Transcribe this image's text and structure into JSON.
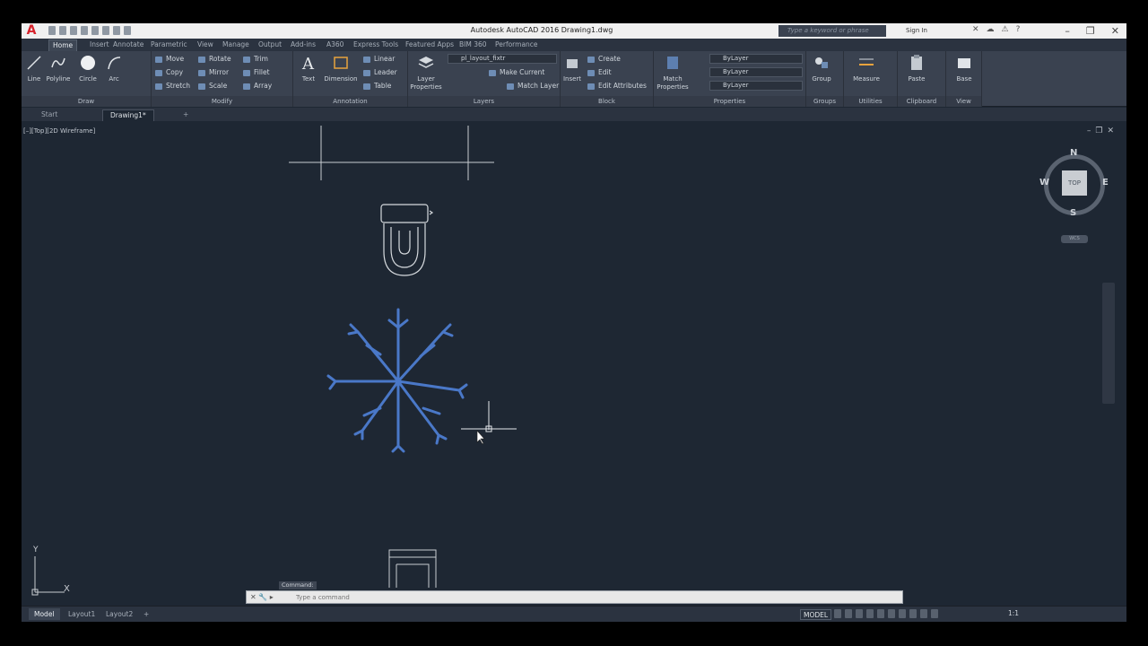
{
  "app": {
    "title": "Autodesk AutoCAD 2016   Drawing1.dwg",
    "logo": "A",
    "search_placeholder": "Type a keyword or phrase",
    "signin_label": "Sign In"
  },
  "ribbon_tabs": [
    "Home",
    "Insert",
    "Annotate",
    "Parametric",
    "View",
    "Manage",
    "Output",
    "Add-ins",
    "A360",
    "Express Tools",
    "Featured Apps",
    "BIM 360",
    "Performance"
  ],
  "draw": {
    "label": "Draw",
    "line": "Line",
    "polyline": "Polyline",
    "circle": "Circle",
    "arc": "Arc"
  },
  "modify": {
    "label": "Modify",
    "move": "Move",
    "rotate": "Rotate",
    "trim": "Trim",
    "copy": "Copy",
    "mirror": "Mirror",
    "fillet": "Fillet",
    "stretch": "Stretch",
    "scale": "Scale",
    "array": "Array"
  },
  "annotation": {
    "label": "Annotation",
    "text": "Text",
    "dimension": "Dimension",
    "linear": "Linear",
    "leader": "Leader",
    "table": "Table"
  },
  "layers": {
    "label": "Layers",
    "layer_properties": "Layer Properties",
    "current_layer": "pl_layout_fixtr",
    "make_current": "Make Current",
    "match_layer": "Match Layer"
  },
  "block": {
    "label": "Block",
    "insert": "Insert",
    "create": "Create",
    "edit": "Edit",
    "edit_attributes": "Edit Attributes"
  },
  "properties": {
    "label": "Properties",
    "match_properties": "Match Properties",
    "color": "ByLayer",
    "linetype": "ByLayer",
    "lineweight": "ByLayer"
  },
  "groups": {
    "label": "Groups",
    "group": "Group"
  },
  "utilities": {
    "label": "Utilities",
    "measure": "Measure"
  },
  "clipboard": {
    "label": "Clipboard",
    "paste": "Paste"
  },
  "view_panel": {
    "label": "View",
    "base": "Base"
  },
  "file_tabs": [
    "Start",
    "Drawing1*"
  ],
  "viewport": {
    "label": "[–][Top][2D Wireframe]"
  },
  "viewcube": {
    "face": "TOP",
    "n": "N",
    "s": "S",
    "e": "E",
    "w": "W",
    "wcs": "WCS"
  },
  "command": {
    "history": "Command:",
    "placeholder": "Type a command"
  },
  "status": {
    "layout_tabs": [
      "Model",
      "Layout1",
      "Layout2"
    ],
    "model_label": "MODEL",
    "scale": "1:1"
  },
  "ucs": {
    "x": "X",
    "y": "Y"
  },
  "colors": {
    "canvas": "#1e2733",
    "ribbon": "#3a4250",
    "tree": "#4a78c8",
    "logo": "#d6232c"
  }
}
